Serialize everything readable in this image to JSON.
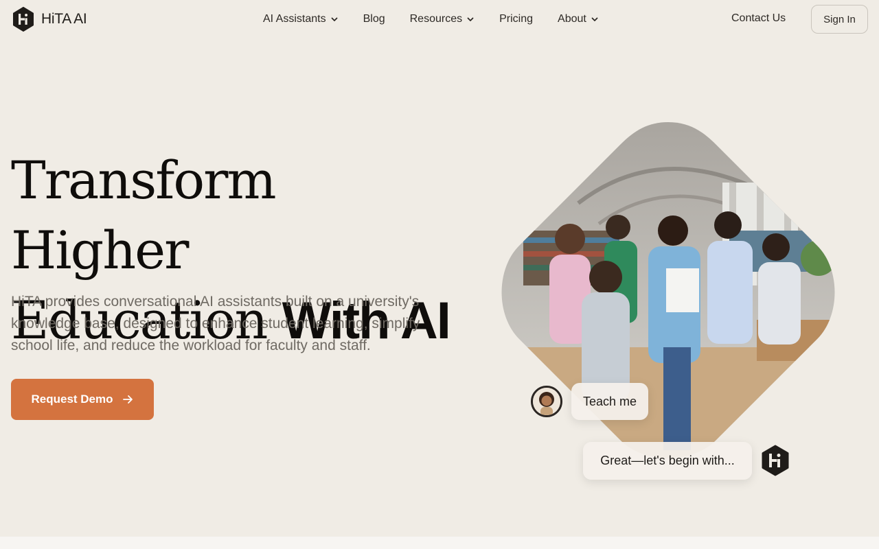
{
  "brand": {
    "name": "HiTA AI"
  },
  "nav": {
    "items": [
      {
        "label": "AI Assistants",
        "dropdown": true
      },
      {
        "label": "Blog",
        "dropdown": false
      },
      {
        "label": "Resources",
        "dropdown": true
      },
      {
        "label": "Pricing",
        "dropdown": false
      },
      {
        "label": "About",
        "dropdown": true
      }
    ],
    "contact_label": "Contact Us",
    "signin_label": "Sign In"
  },
  "hero": {
    "headline_line1": "Transform Higher",
    "headline_line2_serif": "Education",
    "headline_line2_sans": "With AI",
    "description": "HiTA provides conversational AI assistants built on a university's knowledge base, designed to enhance student learning, simplify school life, and reduce the workload for faculty and staff.",
    "cta_label": "Request Demo"
  },
  "chat": {
    "user_message": "Teach me",
    "ai_message": "Great—let's begin with..."
  },
  "colors": {
    "background": "#f0ece5",
    "accent": "#d4733f",
    "text_dark": "#0f0d0b",
    "text_muted": "#6f6a63"
  },
  "icons": {
    "logo": "hita-hexagon-logo",
    "dropdown": "chevron-down-icon",
    "cta_arrow": "arrow-right-icon"
  }
}
